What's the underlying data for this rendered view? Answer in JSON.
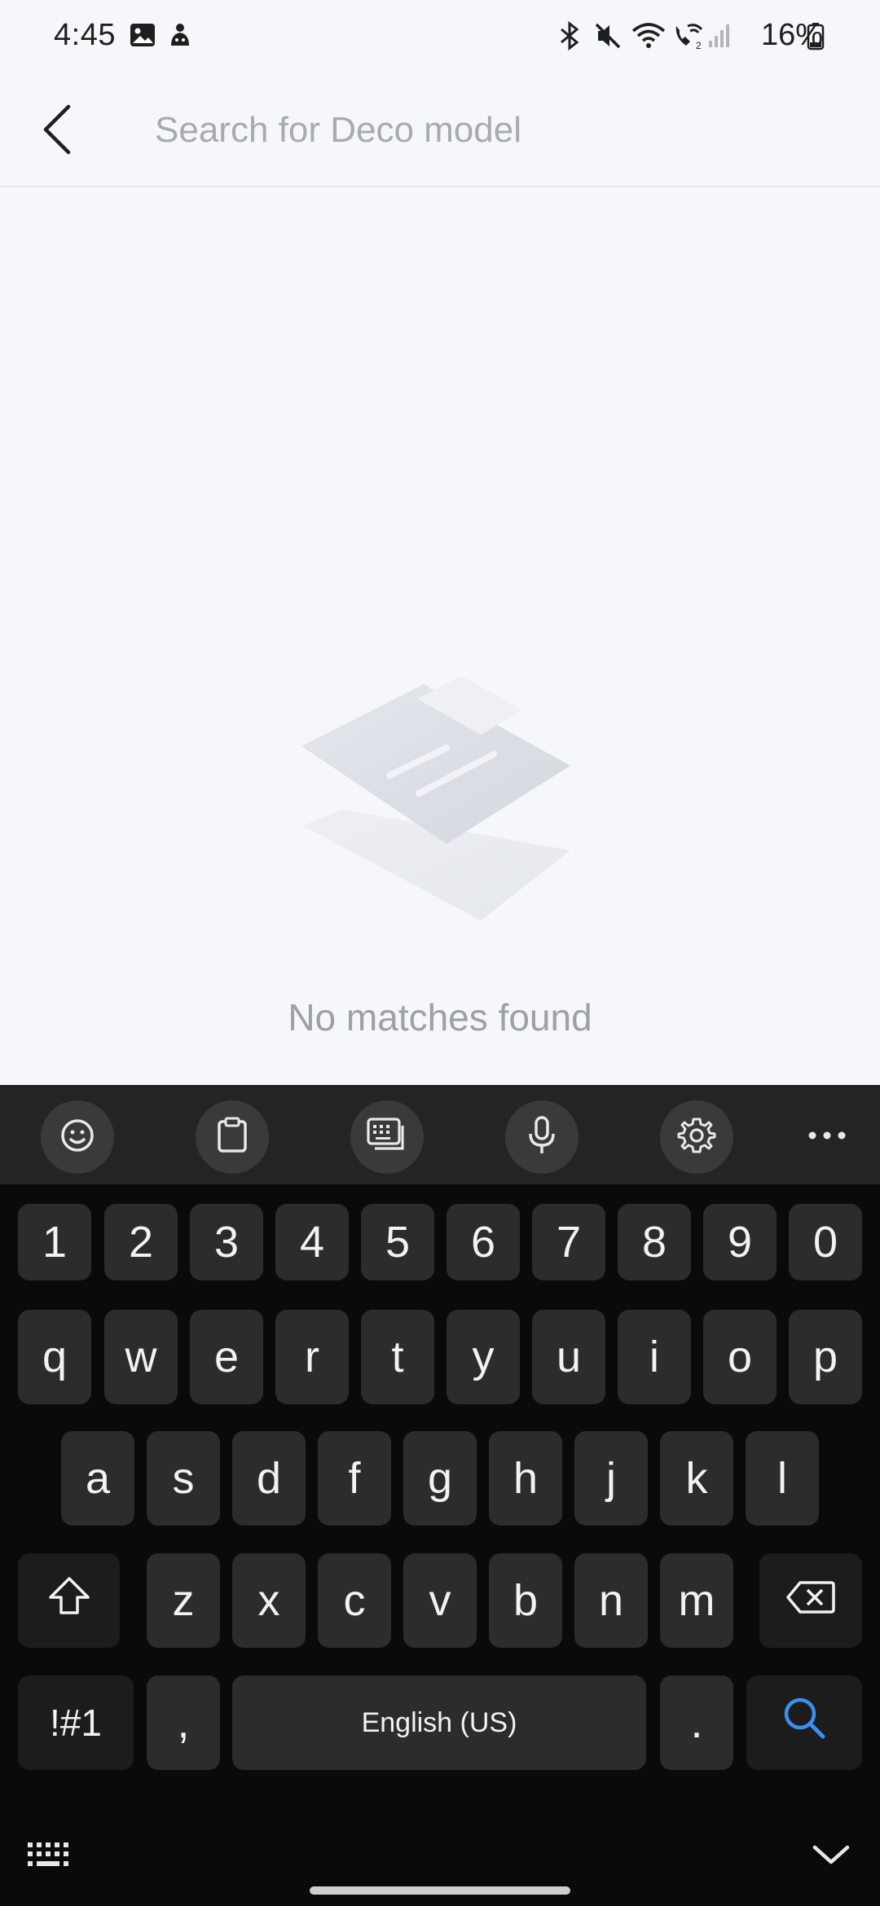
{
  "status_bar": {
    "time": "4:45",
    "battery": "16%",
    "icons": [
      "gallery-icon",
      "notification-app-icon",
      "bluetooth-icon",
      "mute-icon",
      "wifi-icon",
      "wifi-calling-icon",
      "signal-icon",
      "battery-icon"
    ]
  },
  "header": {
    "back_icon": "back-arrow-icon",
    "search_placeholder": "Search for Deco model",
    "search_value": ""
  },
  "empty_state": {
    "message": "No matches found",
    "illustration": "empty-documents-illustration"
  },
  "keyboard": {
    "toolbar": [
      "emoji-icon",
      "clipboard-icon",
      "keyboard-mode-icon",
      "microphone-icon",
      "settings-icon",
      "more-icon"
    ],
    "row_numbers": [
      "1",
      "2",
      "3",
      "4",
      "5",
      "6",
      "7",
      "8",
      "9",
      "0"
    ],
    "row_top": [
      "q",
      "w",
      "e",
      "r",
      "t",
      "y",
      "u",
      "i",
      "o",
      "p"
    ],
    "row_middle": [
      "a",
      "s",
      "d",
      "f",
      "g",
      "h",
      "j",
      "k",
      "l"
    ],
    "row_bottom": [
      "z",
      "x",
      "c",
      "v",
      "b",
      "n",
      "m"
    ],
    "symbols_label": "!#1",
    "comma_label": ",",
    "space_label": "English (US)",
    "period_label": ".",
    "action_icon": "search-icon",
    "accent_color": "#3a8ff0"
  }
}
